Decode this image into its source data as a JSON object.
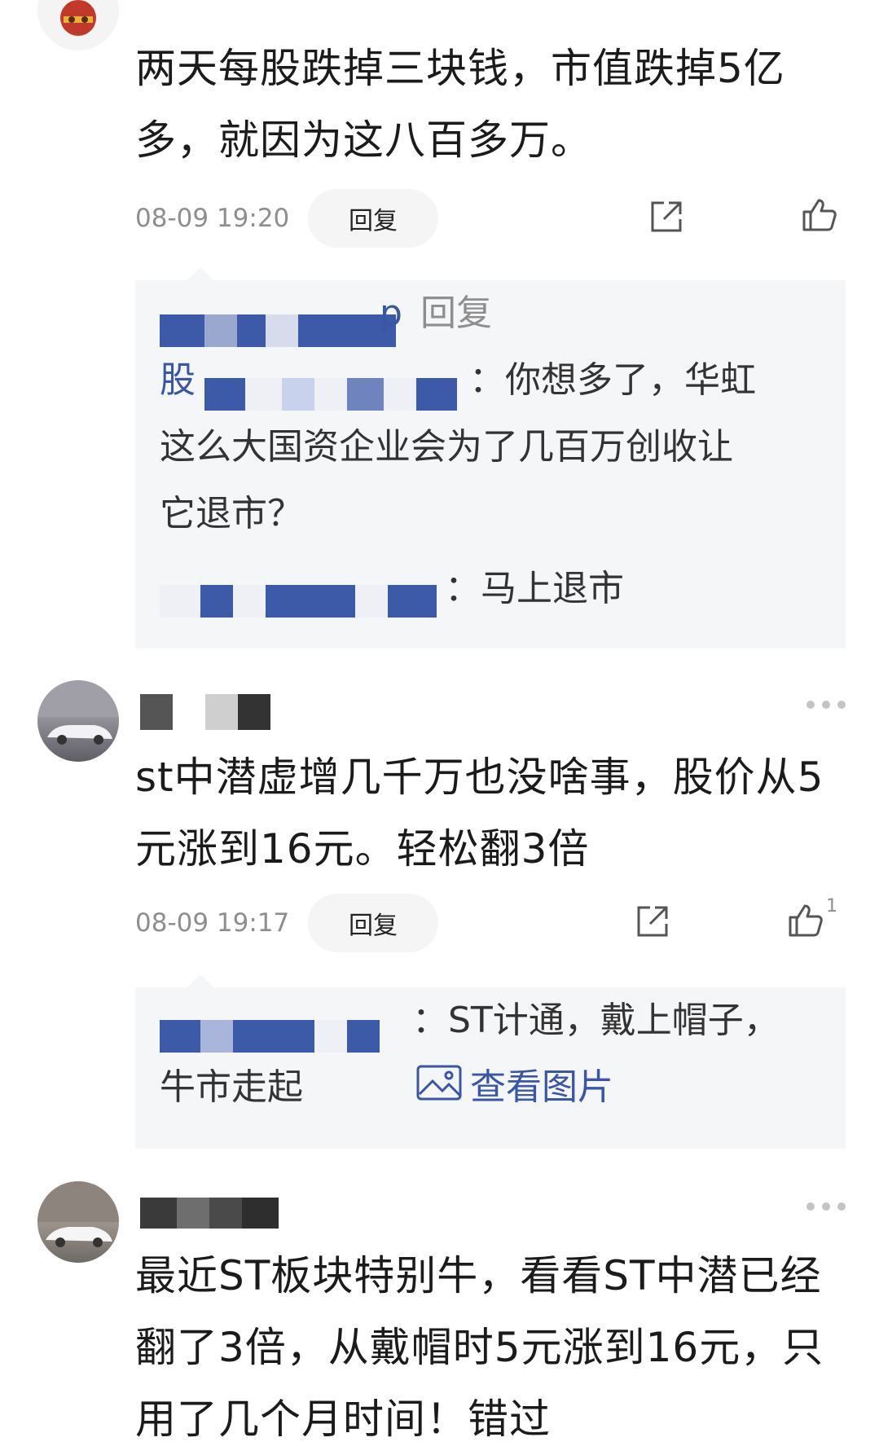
{
  "comments": [
    {
      "content": "两天每股跌掉三块钱，市值跌掉5亿多，就因为这八百多万。",
      "time": "08-09 19:20",
      "reply_label": "回复",
      "replies": {
        "header_reply_word": "回复",
        "item1_name_prefix": "股",
        "item1_text": "：你想多了，华虹这么大国资企业会为了几百万创收让它退市？",
        "item2_text": "：马上退市"
      }
    },
    {
      "content": "st中潜虚增几千万也没啥事，股价从5元涨到16元。轻松翻3倍",
      "time": "08-09 19:17",
      "reply_label": "回复",
      "like_count": "1",
      "replies": {
        "item1_text": "：ST计通，戴上帽子，牛市走起",
        "view_image_label": "查看图片"
      }
    },
    {
      "content": "最近ST板块特别牛，看看ST中潜已经翻了3倍，从戴帽时5元涨到16元，只用了几个月时间！错过"
    }
  ]
}
